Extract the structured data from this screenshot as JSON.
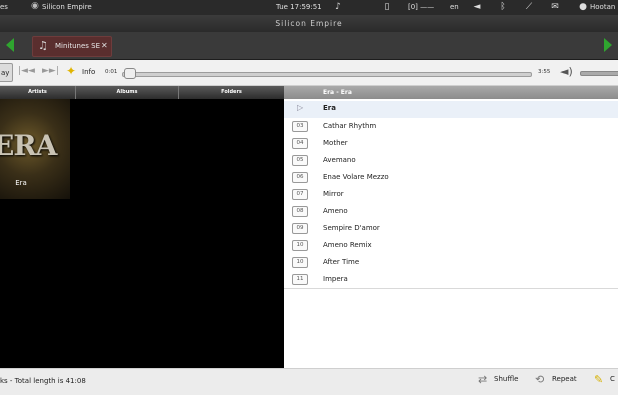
{
  "system_panel": {
    "menu_fragment": "es",
    "app_name": "Silicon Empire",
    "clock": "Tue 17:59:51",
    "indicator_text": "[0] ——",
    "language": "en",
    "user": "Hootan B"
  },
  "window": {
    "title": "Silicon Empire"
  },
  "tabs": [
    {
      "label": "Minitunes SE"
    }
  ],
  "toolbar": {
    "play_label": "ay",
    "info_label": "Info",
    "time_elapsed": "0:01",
    "time_total": "3:55",
    "seek_progress": 0.005
  },
  "browser": {
    "columns": [
      "Artists",
      "Albums",
      "Folders"
    ],
    "album_art_text": "ERA",
    "artist_caption": "Era"
  },
  "playlist": {
    "header": "Era - Era",
    "group_title": "Era",
    "tracks": [
      {
        "num": "03",
        "title": "Cathar Rhythm"
      },
      {
        "num": "04",
        "title": "Mother"
      },
      {
        "num": "05",
        "title": "Avemano"
      },
      {
        "num": "06",
        "title": "Enae Volare Mezzo"
      },
      {
        "num": "07",
        "title": "Mirror"
      },
      {
        "num": "08",
        "title": "Ameno"
      },
      {
        "num": "09",
        "title": "Sempire D'amor"
      },
      {
        "num": "10",
        "title": "Ameno Remix"
      },
      {
        "num": "10",
        "title": "After Time"
      },
      {
        "num": "11",
        "title": "Impera"
      }
    ]
  },
  "statusbar": {
    "status_text": "ks - Total length is 41:08",
    "shuffle_label": "Shuffle",
    "repeat_label": "Repeat",
    "clear_label": "C"
  },
  "icons": {
    "music-note-icon": "♫",
    "info-icon": "star",
    "tab-arrow-color": "#2fa52f",
    "tab-color": "#5a2e2e"
  }
}
